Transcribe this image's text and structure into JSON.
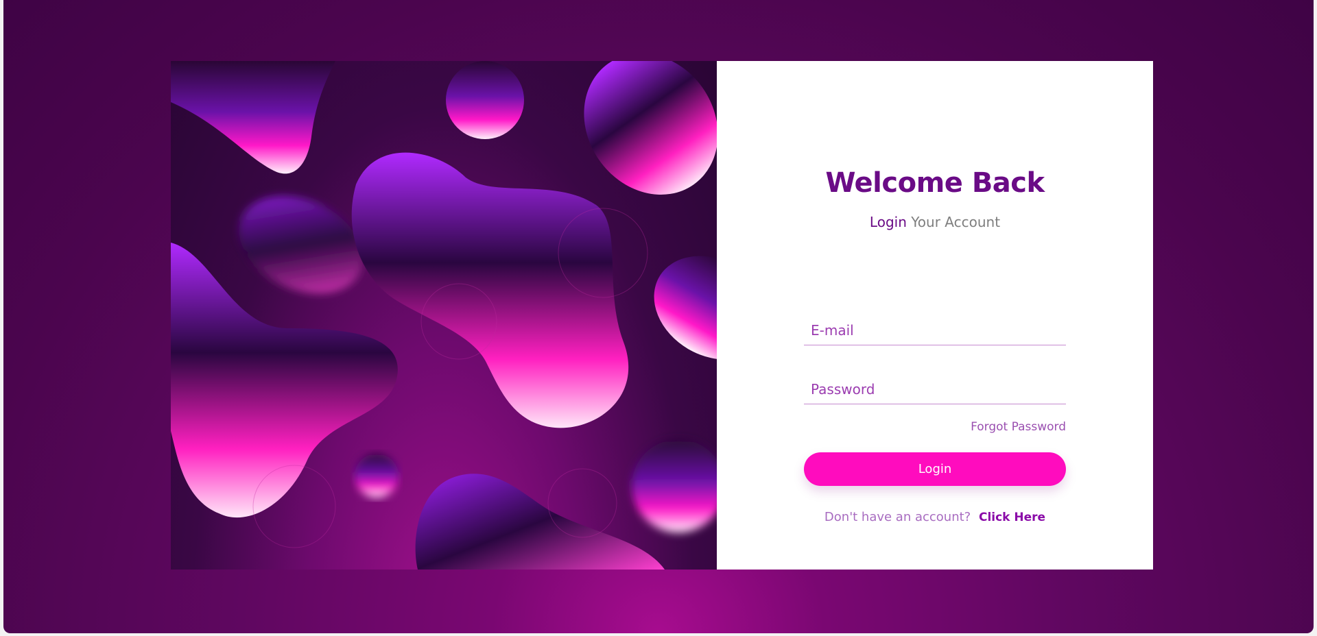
{
  "login": {
    "title": "Welcome Back",
    "subtitle_strong": "Login",
    "subtitle_rest": "Your Account",
    "email_placeholder": "E-mail",
    "password_placeholder": "Password",
    "forgot_label": "Forgot Password",
    "submit_label": "Login",
    "signup_prompt": "Don't have an account?",
    "signup_link": "Click Here"
  },
  "theme": {
    "background": "#4b054e",
    "accent": "#ff0cbe",
    "heading": "#6a0b86"
  }
}
